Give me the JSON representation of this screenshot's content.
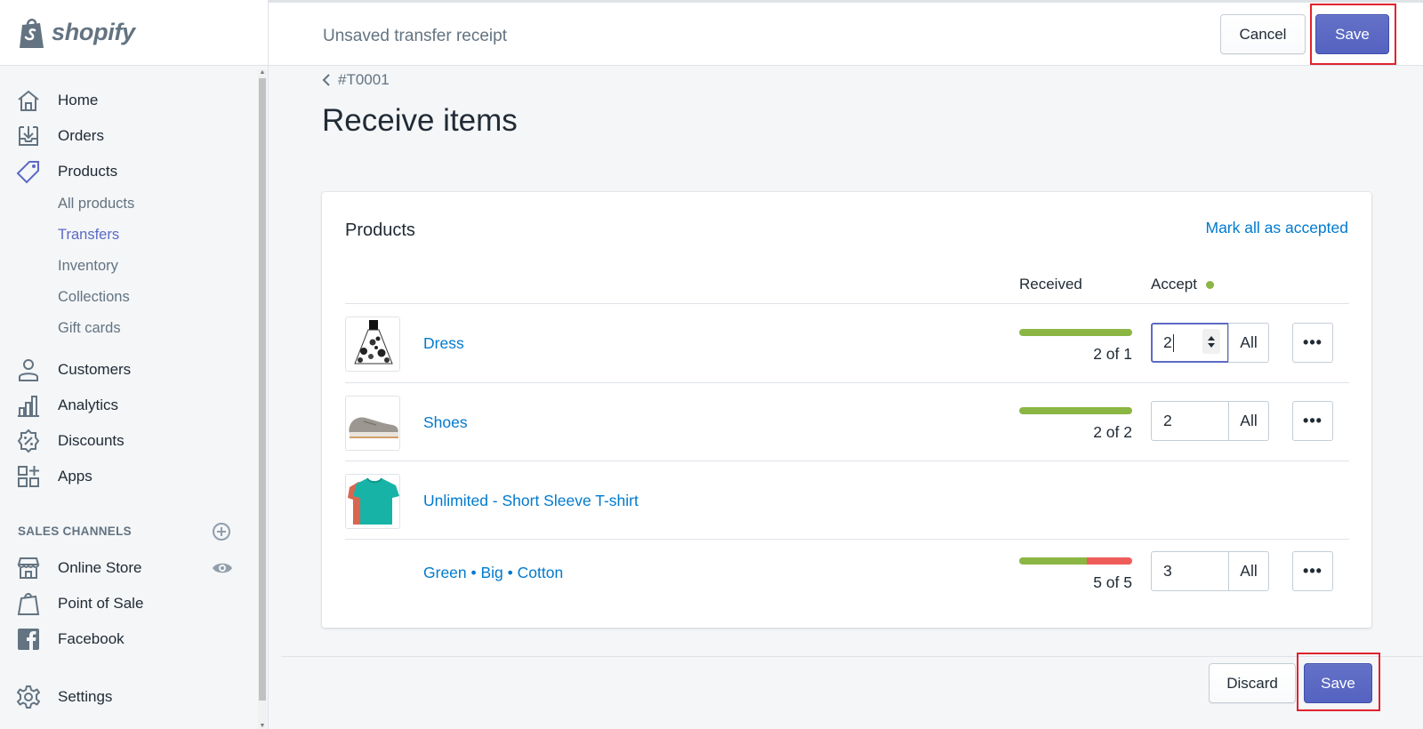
{
  "brand": {
    "name": "shopify"
  },
  "topbar": {
    "title": "Unsaved transfer receipt",
    "cancel_label": "Cancel",
    "save_label": "Save"
  },
  "nav": {
    "items": [
      {
        "label": "Home",
        "icon": "home-icon"
      },
      {
        "label": "Orders",
        "icon": "orders-icon"
      },
      {
        "label": "Products",
        "icon": "tag-icon"
      }
    ],
    "product_sub": [
      "All products",
      "Transfers",
      "Inventory",
      "Collections",
      "Gift cards"
    ],
    "active_sub": "Transfers",
    "items2": [
      {
        "label": "Customers",
        "icon": "customer-icon"
      },
      {
        "label": "Analytics",
        "icon": "analytics-icon"
      },
      {
        "label": "Discounts",
        "icon": "discount-icon"
      },
      {
        "label": "Apps",
        "icon": "apps-icon"
      }
    ],
    "sales_channels_title": "SALES CHANNELS",
    "channels": [
      {
        "label": "Online Store",
        "icon": "store-icon"
      },
      {
        "label": "Point of Sale",
        "icon": "pos-icon"
      },
      {
        "label": "Facebook",
        "icon": "facebook-icon"
      }
    ],
    "settings_label": "Settings"
  },
  "page": {
    "breadcrumb": "#T0001",
    "title": "Receive items"
  },
  "card": {
    "title": "Products",
    "action": "Mark all as accepted",
    "col_received": "Received",
    "col_accept": "Accept",
    "rows": [
      {
        "name": "Dress",
        "received_text": "2 of 1",
        "progress_ok": 1.0,
        "progress_bad": 0,
        "accept": "2",
        "all": "All"
      },
      {
        "name": "Shoes",
        "received_text": "2 of 2",
        "progress_ok": 1.0,
        "progress_bad": 0,
        "accept": "2",
        "all": "All"
      },
      {
        "name": "Unlimited - Short Sleeve T-shirt"
      },
      {
        "name": "Green • Big • Cotton",
        "received_text": "5 of 5",
        "progress_ok": 0.6,
        "progress_bad": 0.4,
        "accept": "3",
        "all": "All"
      }
    ]
  },
  "footer": {
    "discard_label": "Discard",
    "save_label": "Save"
  },
  "colors": {
    "accent": "#5c6ac4",
    "link": "#007ace",
    "progress_ok": "#8bb644",
    "progress_bad": "#ef5d5b",
    "highlight": "#e0232e"
  }
}
